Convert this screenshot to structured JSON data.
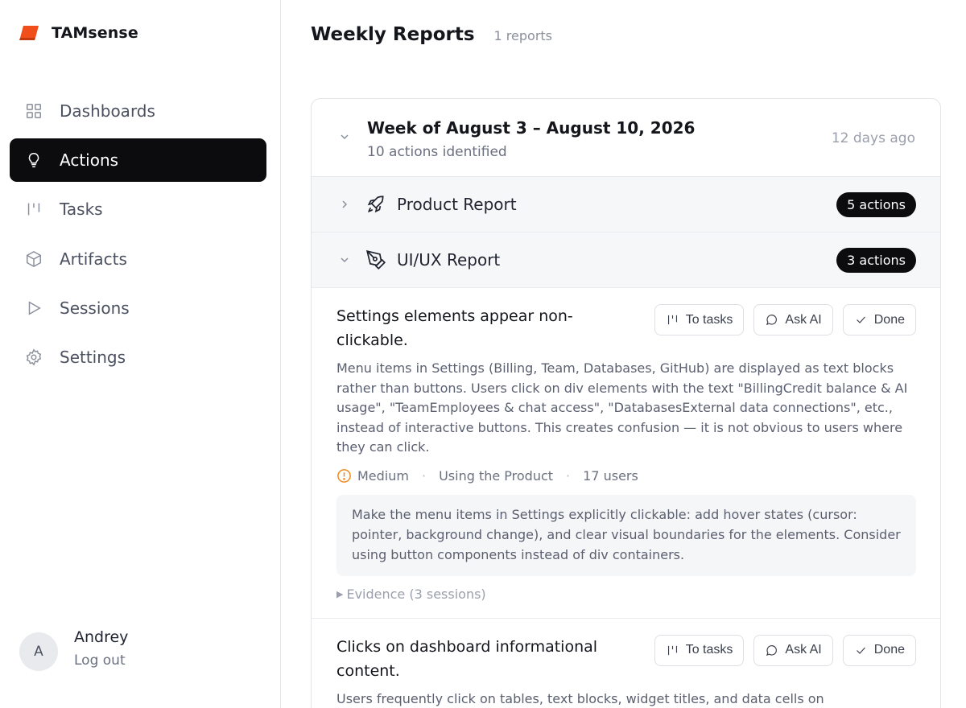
{
  "app": {
    "name": "TAMsense",
    "brand_color": "#f04e1a"
  },
  "sidebar": {
    "items": [
      {
        "label": "Dashboards",
        "icon": "grid-icon",
        "active": false
      },
      {
        "label": "Actions",
        "icon": "lightbulb-icon",
        "active": true
      },
      {
        "label": "Tasks",
        "icon": "kanban-icon",
        "active": false
      },
      {
        "label": "Artifacts",
        "icon": "cube-icon",
        "active": false
      },
      {
        "label": "Sessions",
        "icon": "play-icon",
        "active": false
      },
      {
        "label": "Settings",
        "icon": "gear-icon",
        "active": false
      }
    ],
    "user": {
      "initial": "A",
      "name": "Andrey",
      "logout_label": "Log out"
    }
  },
  "header": {
    "title": "Weekly Reports",
    "count": "1 reports"
  },
  "week": {
    "title": "Week of August 3 – August 10, 2026",
    "subtitle": "10 actions identified",
    "time_ago": "12 days ago"
  },
  "reports": [
    {
      "name": "Product Report",
      "badge": "5 actions",
      "expanded": false,
      "icon": "rocket-icon"
    },
    {
      "name": "UI/UX Report",
      "badge": "3 actions",
      "expanded": true,
      "icon": "pen-tool-icon"
    }
  ],
  "buttons": {
    "to_tasks": "To tasks",
    "ask_ai": "Ask AI",
    "done": "Done"
  },
  "actions": [
    {
      "title": "Settings elements appear non-clickable.",
      "description": "Menu items in Settings (Billing, Team, Databases, GitHub) are displayed as text blocks rather than buttons. Users click on div elements with the text \"BillingCredit balance & AI usage\", \"TeamEmployees & chat access\", \"DatabasesExternal data connections\", etc., instead of interactive buttons. This creates confusion — it is not obvious to users where they can click.",
      "severity": "Medium",
      "severity_color": "#f08a1e",
      "category": "Using the Product",
      "users": "17 users",
      "recommendation": "Make the menu items in Settings explicitly clickable: add hover states (cursor: pointer, background change), and clear visual boundaries for the elements. Consider using button components instead of div containers.",
      "evidence": "Evidence (3 sessions)"
    },
    {
      "title": "Clicks on dashboard informational content.",
      "description": "Users frequently click on tables, text blocks, widget titles, and data cells on"
    }
  ]
}
